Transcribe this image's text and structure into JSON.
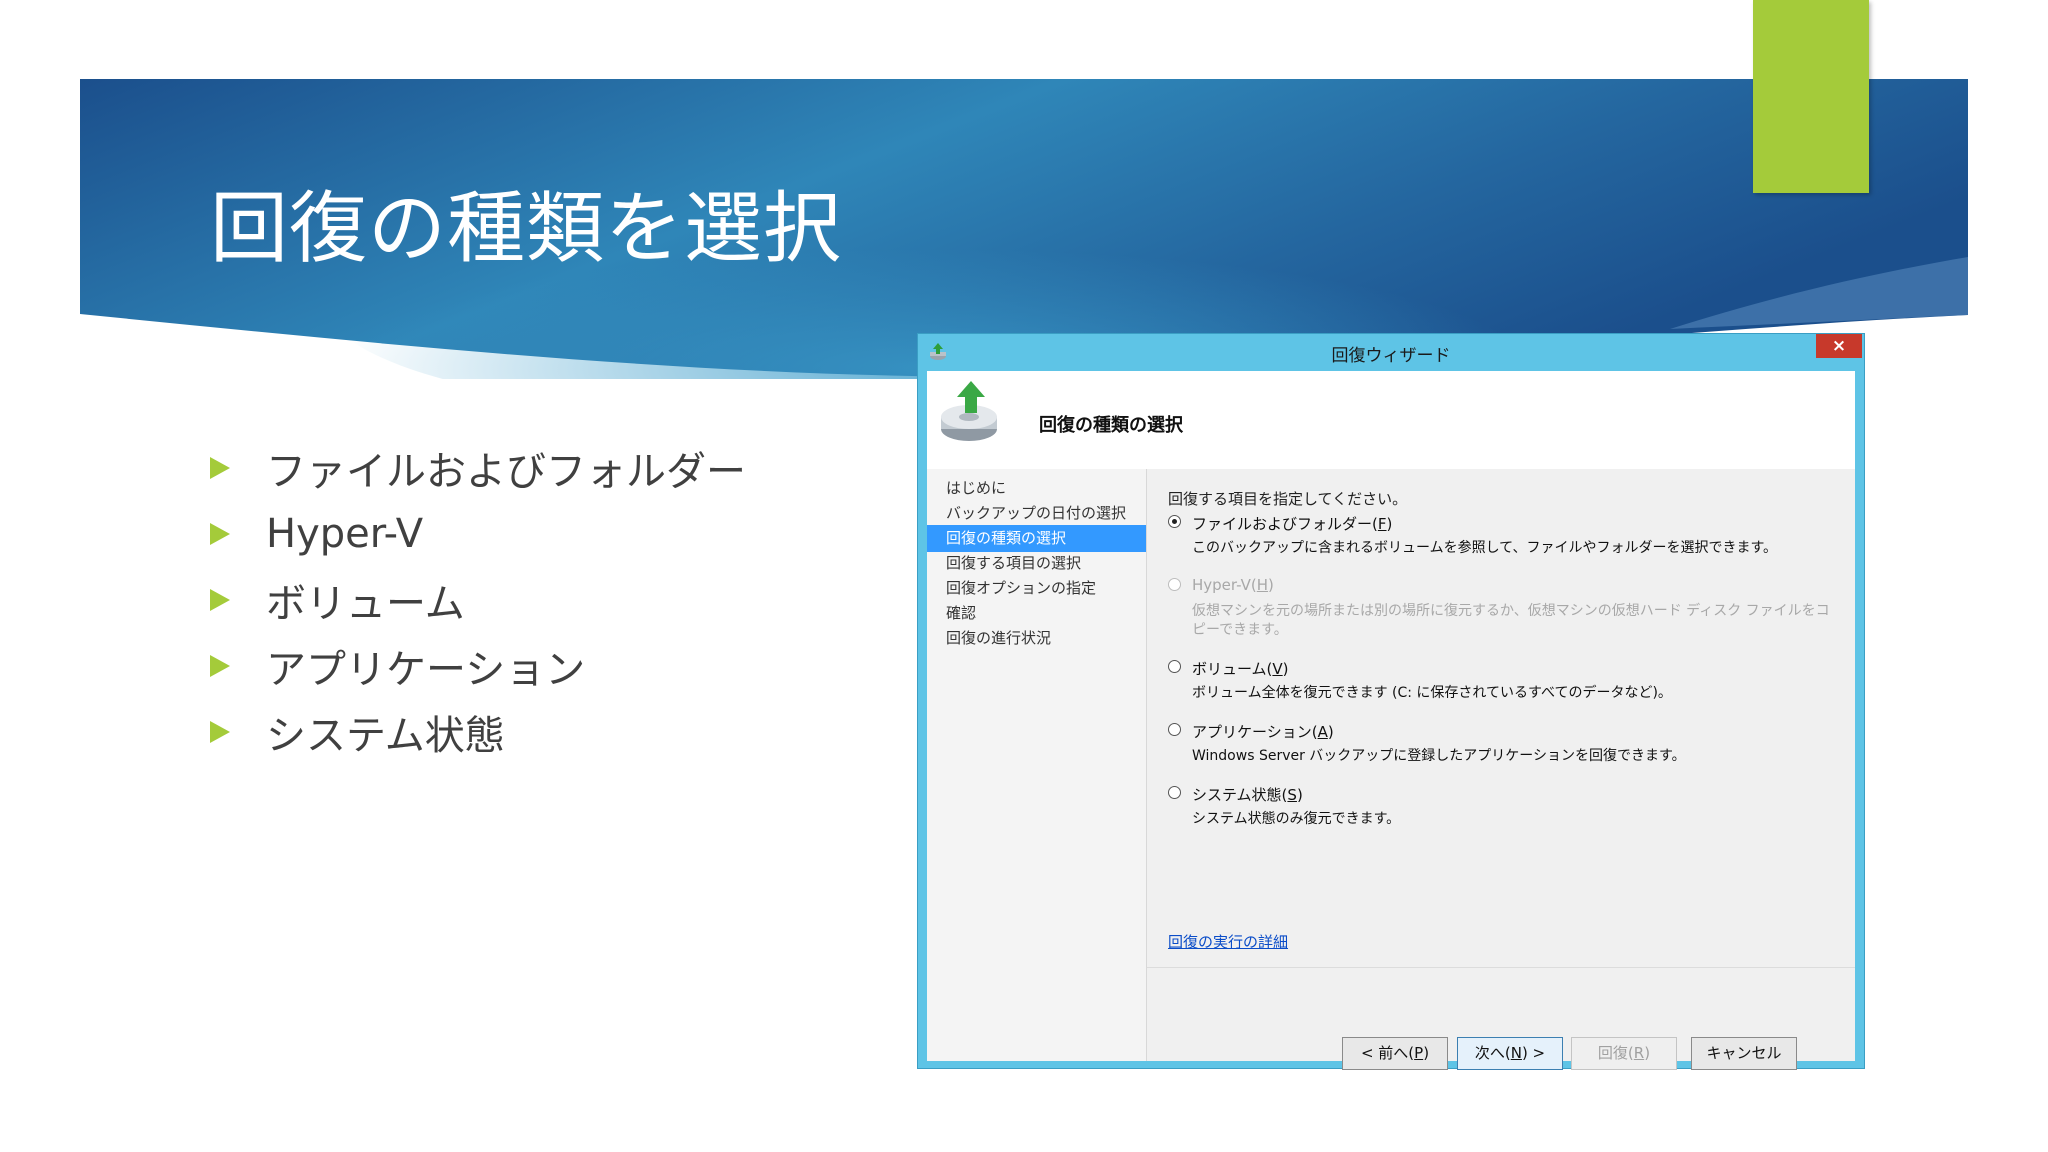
{
  "slide": {
    "title": "回復の種類を選択",
    "bullets": [
      "ファイルおよびフォルダー",
      "Hyper-V",
      "ボリューム",
      "アプリケーション",
      "システム状態"
    ]
  },
  "colors": {
    "banner_dark": "#1b4f8c",
    "banner_light": "#2f86b8",
    "accent_green": "#a4cb3a",
    "dialog_frame": "#5ec4e6",
    "close_red": "#c7392b",
    "nav_selected": "#3399ff",
    "link": "#0a4cc8"
  },
  "dialog": {
    "title": "回復ウィザード",
    "close_label": "×",
    "header_title": "回復の種類の選択",
    "nav": [
      "はじめに",
      "バックアップの日付の選択",
      "回復の種類の選択",
      "回復する項目の選択",
      "回復オプションの指定",
      "確認",
      "回復の進行状況"
    ],
    "selected_nav": "回復の種類の選択",
    "prompt": "回復する項目を指定してください。",
    "options": [
      {
        "label": "ファイルおよびフォルダー(",
        "key": "F",
        "suffix": ")",
        "desc": "このバックアップに含まれるボリュームを参照して、ファイルやフォルダーを選択できます。",
        "checked": true,
        "enabled": true
      },
      {
        "label": "Hyper-V(",
        "key": "H",
        "suffix": ")",
        "desc": "仮想マシンを元の場所または別の場所に復元するか、仮想マシンの仮想ハード ディスク ファイルをコピーできます。",
        "checked": false,
        "enabled": false
      },
      {
        "label": "ボリューム(",
        "key": "V",
        "suffix": ")",
        "desc": "ボリューム全体を復元できます (C: に保存されているすべてのデータなど)。",
        "checked": false,
        "enabled": true
      },
      {
        "label": "アプリケーション(",
        "key": "A",
        "suffix": ")",
        "desc": "Windows Server バックアップに登録したアプリケーションを回復できます。",
        "checked": false,
        "enabled": true
      },
      {
        "label": "システム状態(",
        "key": "S",
        "suffix": ")",
        "desc": "システム状態のみ復元できます。",
        "checked": false,
        "enabled": true
      }
    ],
    "details_link": "回復の実行の詳細",
    "buttons": {
      "back": {
        "pre": "< 前へ(",
        "key": "P",
        "post": ")"
      },
      "next": {
        "pre": "次へ(",
        "key": "N",
        "post": ") >"
      },
      "recover": {
        "pre": "回復(",
        "key": "R",
        "post": ")"
      },
      "cancel": "キャンセル"
    }
  }
}
